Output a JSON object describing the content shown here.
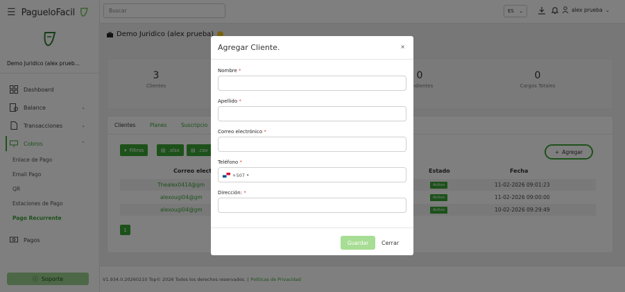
{
  "brand": {
    "name": "PagueloFacil"
  },
  "account": {
    "name": "Demo Juridico (alex prueb..."
  },
  "nav": {
    "dashboard": "Dashboard",
    "balance": "Balance",
    "transacciones": "Transacciones",
    "cobros": "Cobros",
    "pagos": "Pagos",
    "sub": [
      "Enlace de Pago",
      "Email Pago",
      "QR",
      "Estaciones de Pago",
      "Pago Recurrente"
    ]
  },
  "support_label": "Soporte",
  "topbar": {
    "search_placeholder": "Buscar",
    "lang": "ES",
    "user": "alex prueba"
  },
  "page_title": "Demo Juridico (alex prueba)",
  "stats": [
    {
      "value": "3",
      "label": "Clientes"
    },
    {
      "value": "0",
      "label": "Pendientes"
    },
    {
      "value": "0",
      "label": "Cargos Totales"
    }
  ],
  "tabs": [
    "Clientes",
    "Planes",
    "Suscripcio"
  ],
  "toolbar": {
    "filtros": "Filtros",
    "xlsx": ".xlsx",
    "csv": ".csv",
    "agregar": "Agregar"
  },
  "table": {
    "headers": {
      "email": "Correo electr",
      "estado": "Estado",
      "fecha": "Fecha"
    },
    "rows": [
      {
        "email": "Thealex0414@gm",
        "estado": "Activo",
        "fecha": "11-02-2026 09:01:23"
      },
      {
        "email": "alexougi04@gm",
        "estado": "Activo",
        "fecha": "11-02-2026 09:00:00"
      },
      {
        "email": "alexougi04@gm",
        "estado": "Activo",
        "fecha": "10-02-2026 09:29:49"
      }
    ],
    "page": "1"
  },
  "footer": {
    "text": "V1.934.0.20260210 Top© 2026 Todos los derechos reservados. |",
    "link": "Políticas de Privacidad"
  },
  "modal": {
    "title": "Agregar Cliente.",
    "close": "×",
    "fields": {
      "nombre": "Nombre",
      "apellido": "Apellido",
      "correo": "Correo electrónico",
      "telefono": "Teléfono",
      "direccion": "Dirección:"
    },
    "required_mark": "*",
    "phone_prefix": "+507",
    "save": "Guardar",
    "cancel": "Cerrar"
  },
  "colors": {
    "accent": "#3aa335",
    "save_disabled": "#a7dd94",
    "required": "#e0443a"
  }
}
